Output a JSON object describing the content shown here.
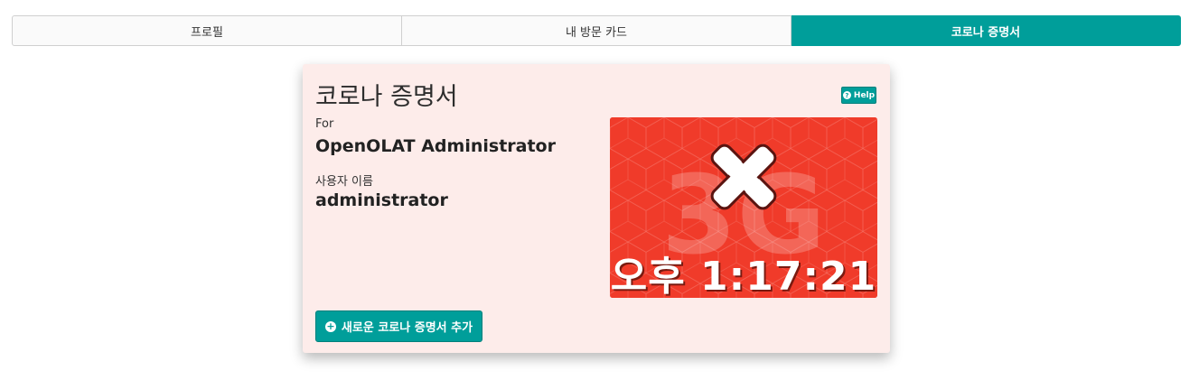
{
  "tabs": [
    {
      "label": "프로필",
      "active": false
    },
    {
      "label": "내 방문 카드",
      "active": false
    },
    {
      "label": "코로나 증명서",
      "active": true
    }
  ],
  "card": {
    "title": "코로나 증명서",
    "help_label": "Help",
    "for_label": "For",
    "full_name": "OpenOLAT Administrator",
    "username_label": "사용자 이름",
    "username": "administrator",
    "certificate": {
      "watermark": "3G",
      "time": "오후 1:17:21",
      "status_icon": "x-mark-icon",
      "background_color": "#f03b2a"
    },
    "add_button_label": "새로운 코로나 증명서 추가"
  },
  "colors": {
    "accent": "#009e9a",
    "card_background": "#fdecea"
  }
}
